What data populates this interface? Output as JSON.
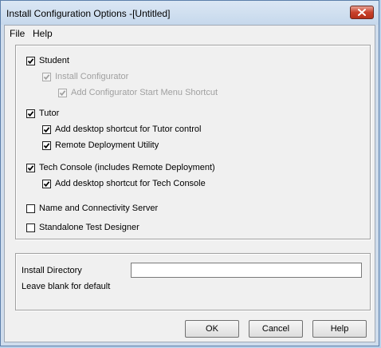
{
  "window": {
    "title": "Install Configuration Options -[Untitled]"
  },
  "menu": {
    "items": [
      "File",
      "Help"
    ]
  },
  "options": {
    "student": {
      "label": "Student",
      "checked": true,
      "enabled": true
    },
    "install_configurator": {
      "label": "Install Configurator",
      "checked": true,
      "enabled": false
    },
    "configurator_shortcut": {
      "label": "Add Configurator Start Menu Shortcut",
      "checked": true,
      "enabled": false
    },
    "tutor": {
      "label": "Tutor",
      "checked": true,
      "enabled": true
    },
    "tutor_shortcut": {
      "label": "Add desktop shortcut for Tutor control",
      "checked": true,
      "enabled": true
    },
    "remote_deployment": {
      "label": "Remote Deployment Utility",
      "checked": true,
      "enabled": true
    },
    "tech_console": {
      "label": "Tech Console (includes Remote Deployment)",
      "checked": true,
      "enabled": true
    },
    "tech_console_shortcut": {
      "label": "Add desktop shortcut for Tech Console",
      "checked": true,
      "enabled": true
    },
    "name_server": {
      "label": "Name and Connectivity Server",
      "checked": false,
      "enabled": true
    },
    "test_designer": {
      "label": "Standalone Test Designer",
      "checked": false,
      "enabled": true
    }
  },
  "install_dir": {
    "label": "Install Directory",
    "hint": "Leave blank for default",
    "value": ""
  },
  "buttons": {
    "ok": "OK",
    "cancel": "Cancel",
    "help": "Help"
  },
  "icons": {
    "close": "close-icon",
    "check": "checkmark-icon"
  },
  "colors": {
    "close_button": "#c8412b",
    "titlebar": "#c6d8ec",
    "client_bg": "#f0f0f0"
  }
}
